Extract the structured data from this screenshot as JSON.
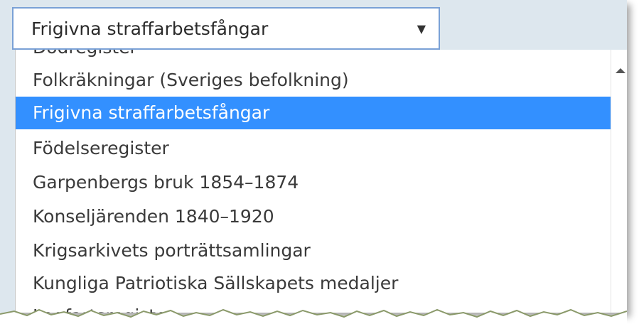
{
  "select": {
    "value": "Frigivna straffarbetsfångar",
    "arrow": "▼"
  },
  "dropdown": {
    "options": [
      {
        "label": "Dödregister",
        "selected": false
      },
      {
        "label": "Folkräkningar (Sveriges befolkning)",
        "selected": false
      },
      {
        "label": "Frigivna straffarbetsfångar",
        "selected": true
      },
      {
        "label": "Födelseregister",
        "selected": false
      },
      {
        "label": "Garpenbergs bruk 1854–1874",
        "selected": false
      },
      {
        "label": "Konseljärenden 1840–1920",
        "selected": false
      },
      {
        "label": "Krigsarkivets porträttsamlingar",
        "selected": false
      },
      {
        "label": "Kungliga Patriotiska Sällskapets medaljer",
        "selected": false
      },
      {
        "label": "Lagfartsregister",
        "selected": false
      }
    ]
  },
  "colors": {
    "selected_bg": "#3390ff",
    "select_border": "#7aa1d6",
    "frame_bg": "#dde7ee"
  },
  "icons": {
    "scroll_up": "scroll-up-icon",
    "dropdown_arrow": "dropdown-arrow-icon"
  }
}
